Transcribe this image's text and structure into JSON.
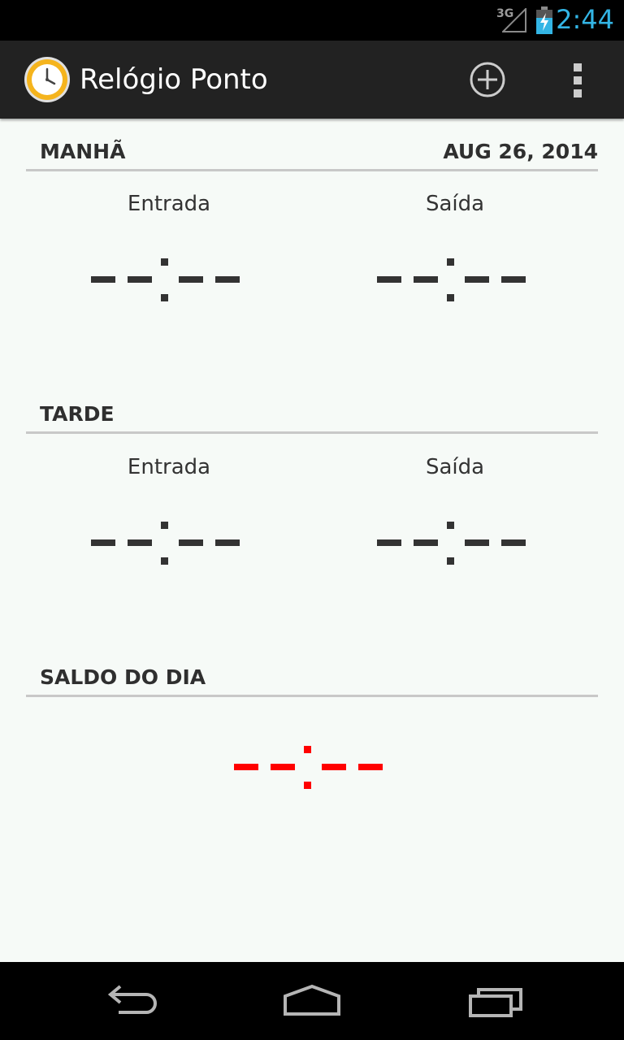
{
  "status_bar": {
    "network": "3G",
    "time": "2:44",
    "icons": [
      "signal-icon",
      "battery-charging-icon"
    ]
  },
  "action_bar": {
    "title": "Relógio Ponto",
    "icons": [
      "clock-app-icon",
      "add-icon",
      "overflow-menu-icon"
    ]
  },
  "morning": {
    "title": "MANHÃ",
    "date": "AUG 26, 2014",
    "entry_label": "Entrada",
    "exit_label": "Saída",
    "entry_time": "--:--",
    "exit_time": "--:--"
  },
  "afternoon": {
    "title": "TARDE",
    "entry_label": "Entrada",
    "exit_label": "Saída",
    "entry_time": "--:--",
    "exit_time": "--:--"
  },
  "balance": {
    "title": "SALDO DO DIA",
    "value": "--:--",
    "color": "#ff0000"
  },
  "colors": {
    "time_text": "#333333",
    "accent": "#33b5e5"
  },
  "nav_bar": {
    "icons": [
      "back-icon",
      "home-icon",
      "recent-apps-icon"
    ]
  }
}
